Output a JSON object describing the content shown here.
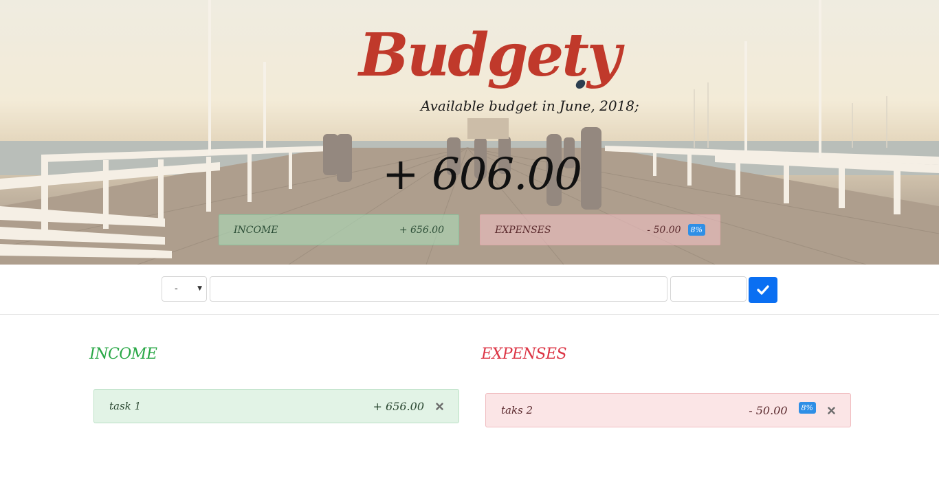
{
  "header": {
    "logo": "Budgety",
    "available_label": "Available budget in",
    "month": "June, 2018;",
    "budget_value": "+ 606.00",
    "income_label": "INCOME",
    "income_value": "+ 656.00",
    "expenses_label": "EXPENSES",
    "expenses_value": "- 50.00",
    "expenses_percentage": "8%"
  },
  "add_form": {
    "type_selected": "-",
    "description_value": "",
    "value_value": ""
  },
  "income_list": {
    "title": "INCOME",
    "items": [
      {
        "description": "task 1",
        "value": "+ 656.00"
      }
    ]
  },
  "expenses_list": {
    "title": "EXPENSES",
    "items": [
      {
        "description": "taks 2",
        "value": "- 50.00",
        "percentage": "8%"
      }
    ]
  },
  "colors": {
    "logo": "#c0392b",
    "income": "#28a745",
    "expenses": "#dc3545",
    "submit": "#0a6ff2",
    "badge": "#2e8fe6"
  },
  "icons": {
    "submit": "checkmark-icon",
    "delete": "close-icon",
    "select": "caret-down-icon"
  }
}
